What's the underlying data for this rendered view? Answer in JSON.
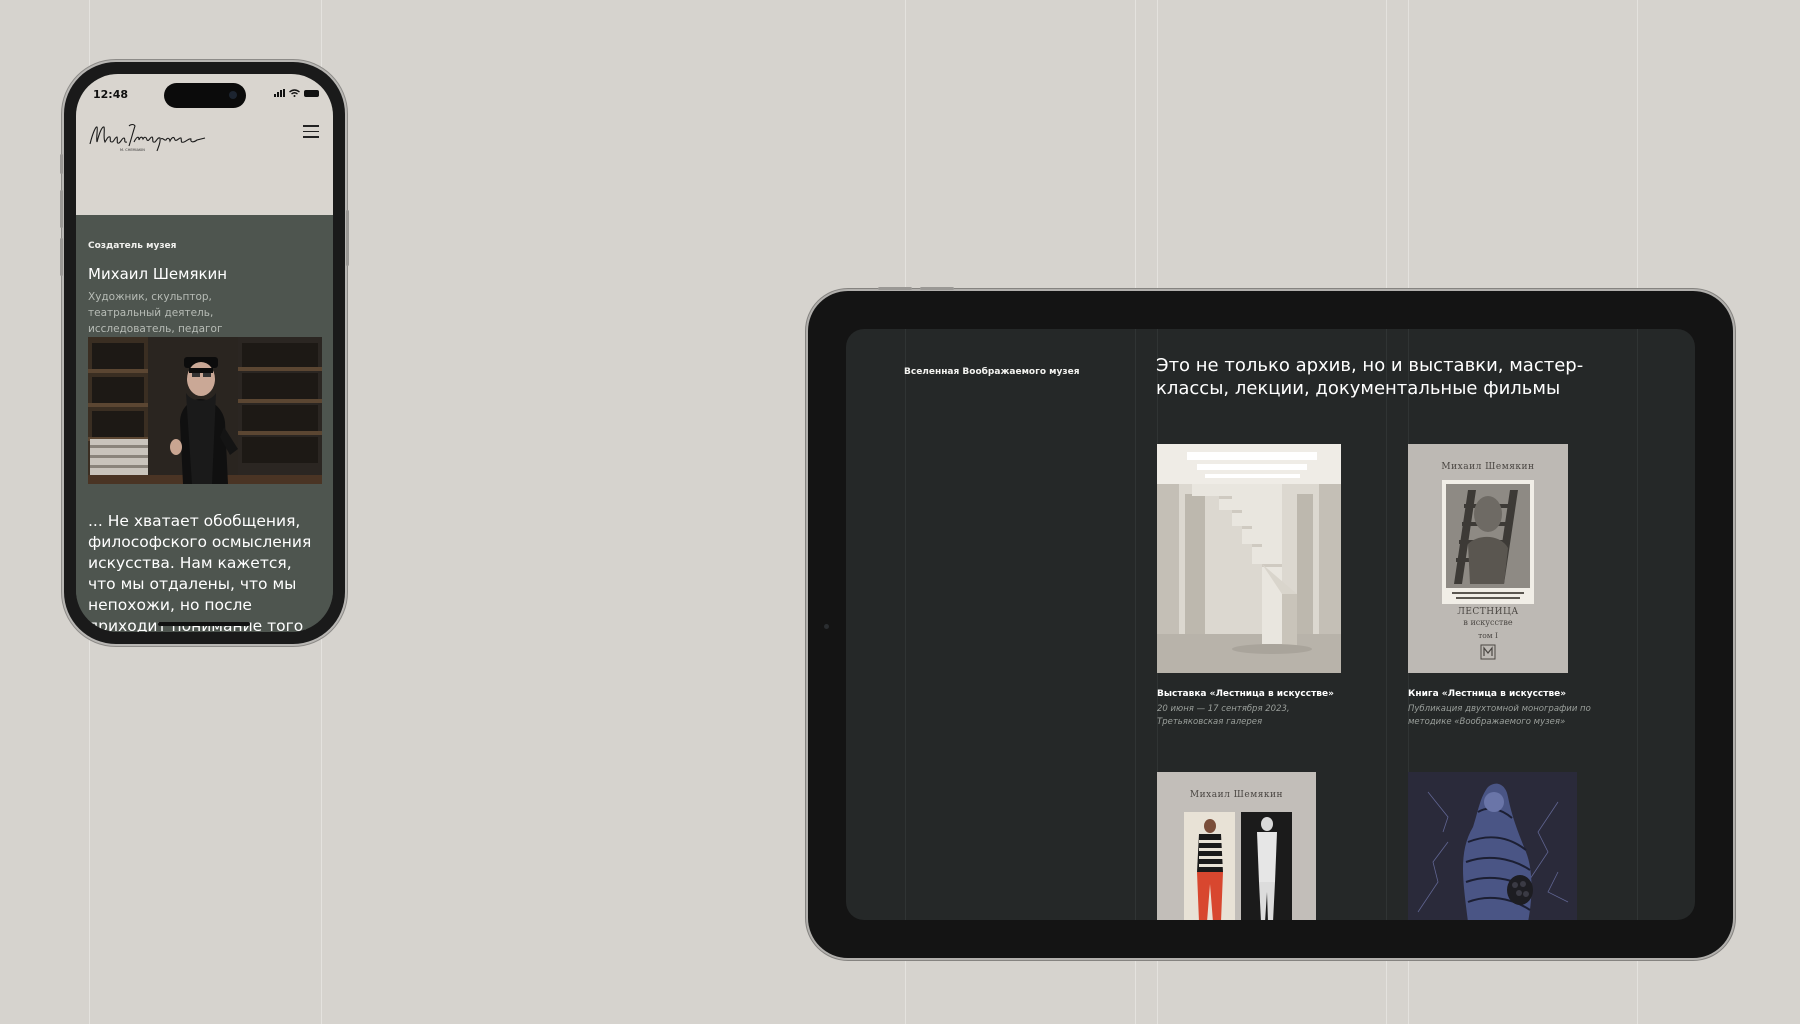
{
  "phone": {
    "status_time": "12:48",
    "logo_icon": "musee-imaginaire-signature-logo",
    "menu_icon": "hamburger-menu-icon",
    "label": "Создатель музея",
    "name": "Михаил Шемякин",
    "description": "Художник, скульптор, театральный деятель, исследователь, педагог",
    "quote": "... Не хватает обобщения, философского осмысления искусства. Нам кажется, что мы отдалены, что мы непохожи, но после приходит понимание того, что пространство переплетается. Когда в разных контекстах"
  },
  "tablet": {
    "section_label": "Вселенная Воображаемого музея",
    "title": "Это не только архив, но и выставки, мастер-классы, лекции, документальные фильмы",
    "cards": [
      {
        "title": "Выставка «Лестница в искусстве»",
        "subtitle": "20 июня — 17 сентября 2023, Третьяковская галерея"
      },
      {
        "title": "Книга «Лестница в искусстве»",
        "subtitle": "Публикация двухтомной монографии по методике «Воображаемого музея»",
        "cover_author": "Михаил Шемякин",
        "cover_title_1": "ЛЕСТНИЦА",
        "cover_title_2": "в искусстве",
        "cover_volume": "том I"
      },
      {
        "cover_author": "Михаил Шемякин"
      },
      {}
    ]
  },
  "colors": {
    "background": "#d6d3ce",
    "phone_content": "#4e554f",
    "tablet_screen": "#252828"
  }
}
